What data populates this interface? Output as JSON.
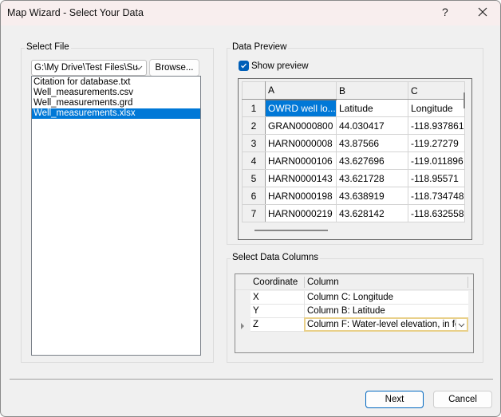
{
  "window": {
    "title": "Map Wizard - Select Your Data",
    "help_label": "?",
    "close_icon": "close-icon"
  },
  "select_file": {
    "group_label": "Select File",
    "path_value": "G:\\My Drive\\Test Files\\Su",
    "browse_label": "Browse...",
    "files": [
      {
        "name": "Citation for database.txt",
        "selected": false
      },
      {
        "name": "Well_measurements.csv",
        "selected": false
      },
      {
        "name": "Well_measurements.grd",
        "selected": false
      },
      {
        "name": "Well_measurements.xlsx",
        "selected": true
      }
    ]
  },
  "data_preview": {
    "group_label": "Data Preview",
    "show_preview_label": "Show preview",
    "show_preview_checked": true,
    "columns": [
      "A",
      "B",
      "C"
    ],
    "rows": [
      {
        "num": "1",
        "cells": [
          "OWRD well lo...",
          "Latitude",
          "Longitude"
        ]
      },
      {
        "num": "2",
        "cells": [
          "GRAN0000800",
          "44.030417",
          "-118.937861"
        ]
      },
      {
        "num": "3",
        "cells": [
          "HARN0000008",
          "43.87566",
          "-119.27279"
        ]
      },
      {
        "num": "4",
        "cells": [
          "HARN0000106",
          "43.627696",
          "-119.011896"
        ]
      },
      {
        "num": "5",
        "cells": [
          "HARN0000143",
          "43.621728",
          "-118.95571"
        ]
      },
      {
        "num": "6",
        "cells": [
          "HARN0000198",
          "43.638919",
          "-118.734748"
        ]
      },
      {
        "num": "7",
        "cells": [
          "HARN0000219",
          "43.628142",
          "-118.632558"
        ]
      }
    ]
  },
  "select_columns": {
    "group_label": "Select Data Columns",
    "headers": [
      "Coordinate",
      "Column"
    ],
    "rows": [
      {
        "coordinate": "X",
        "column": "Column C:  Longitude"
      },
      {
        "coordinate": "Y",
        "column": "Column B:  Latitude"
      },
      {
        "coordinate": "Z",
        "column": "Column F:  Water-level elevation, in feet"
      }
    ]
  },
  "footer": {
    "next_label": "Next",
    "cancel_label": "Cancel"
  }
}
